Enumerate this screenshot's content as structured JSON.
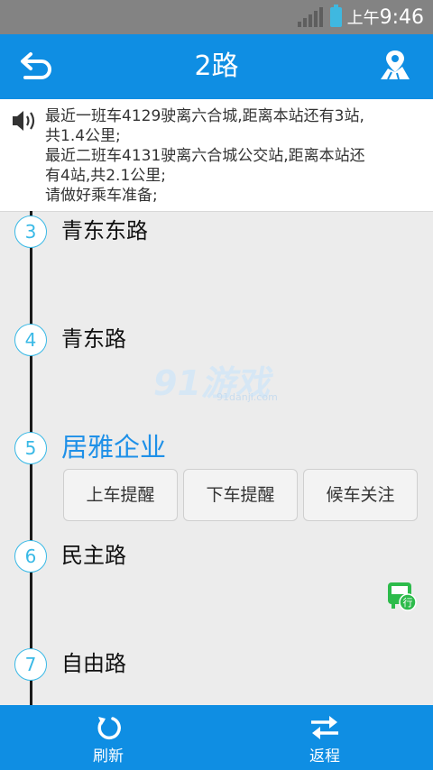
{
  "status": {
    "ampm": "上午",
    "time": "9:46"
  },
  "appbar": {
    "title": "2路"
  },
  "notice": {
    "lines": [
      "最近一班车4129驶离六合城,距离本站还有3站,",
      "共1.4公里;",
      "最近二班车4131驶离六合城公交站,距离本站还",
      "有4站,共2.1公里;",
      "请做好乘车准备;"
    ]
  },
  "stops": [
    {
      "num": "3",
      "name": "青东东路"
    },
    {
      "num": "4",
      "name": "青东路"
    },
    {
      "num": "5",
      "name": "居雅企业"
    },
    {
      "num": "6",
      "name": "民主路"
    },
    {
      "num": "7",
      "name": "自由路"
    }
  ],
  "actions": {
    "board": "上车提醒",
    "alight": "下车提醒",
    "watch": "候车关注"
  },
  "watermark": {
    "brand": "91游戏",
    "site": "91danji.com"
  },
  "bus_badge": "行",
  "bottom": {
    "refresh": "刷新",
    "return": "返程"
  },
  "colors": {
    "primary": "#0f8ee3",
    "accent": "#39b9e6",
    "active": "#1e90e8",
    "bus": "#2dbb4b"
  }
}
